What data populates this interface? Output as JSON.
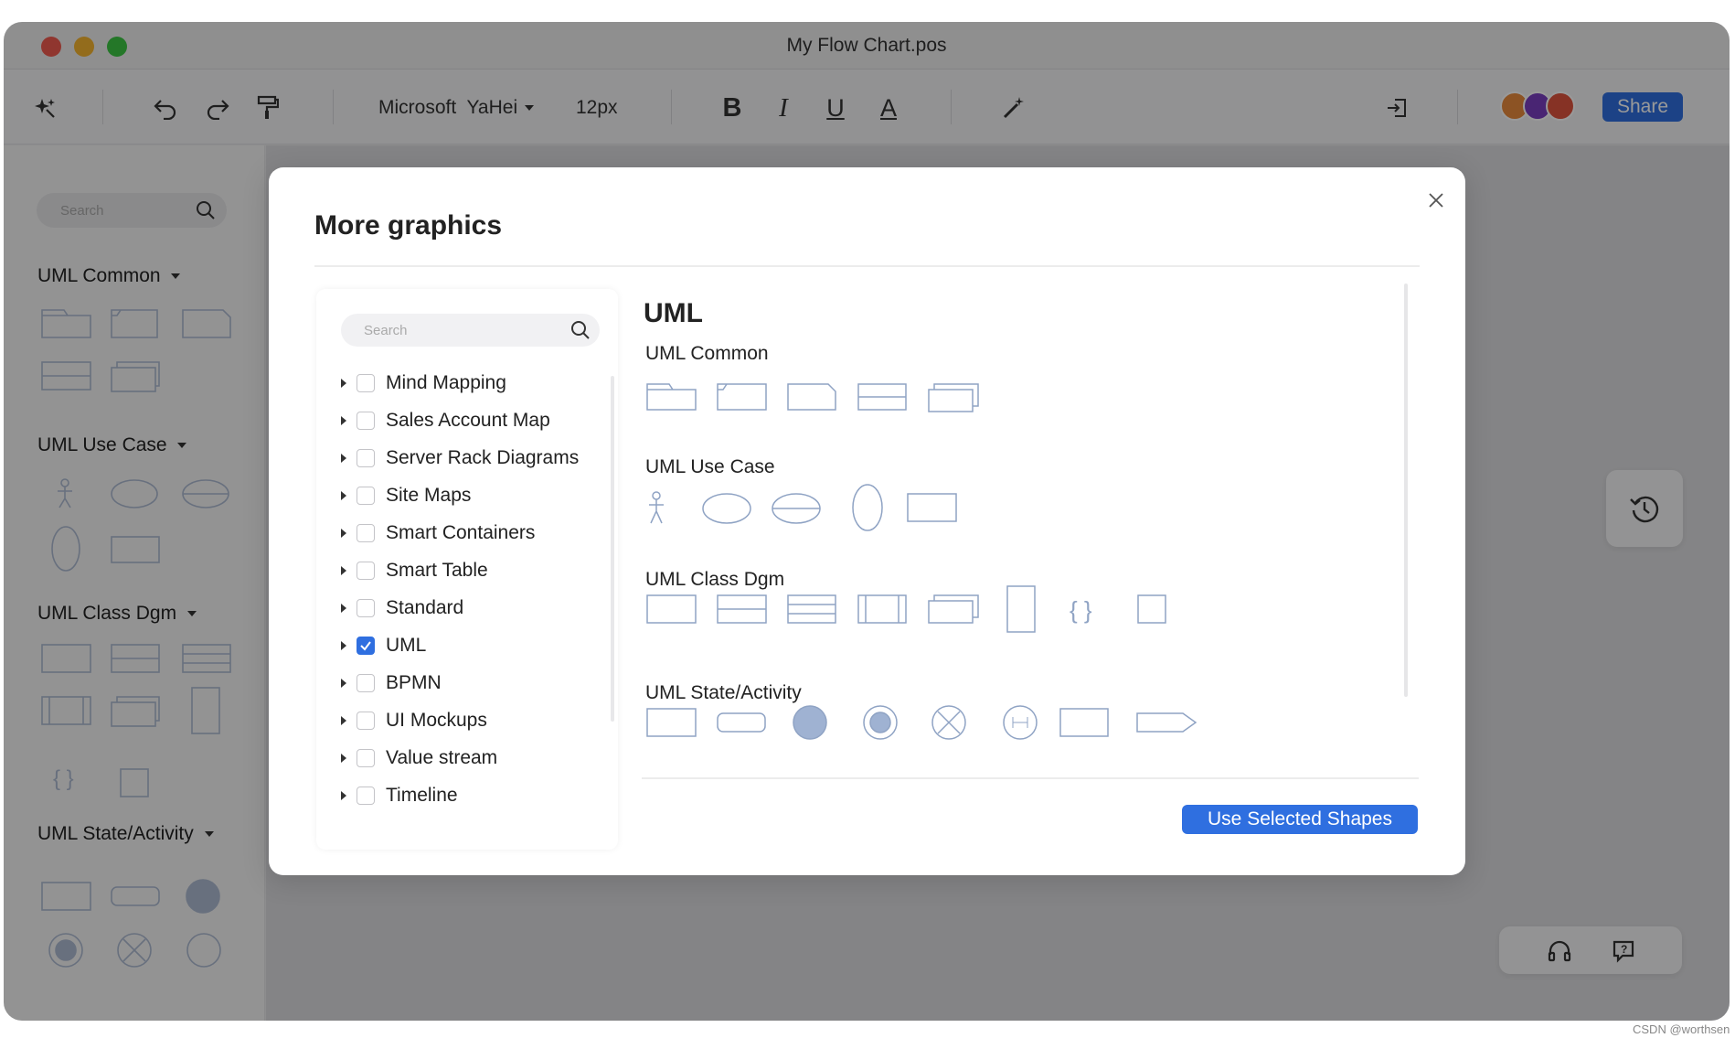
{
  "window": {
    "title": "My Flow Chart.pos"
  },
  "toolbar": {
    "font_family": "Microsoft  YaHei",
    "font_size": "12px",
    "share_label": "Share",
    "icons": [
      "magic-star-icon",
      "undo-icon",
      "redo-icon",
      "format-painter-icon",
      "bold-icon",
      "italic-icon",
      "underline-icon",
      "font-color-icon",
      "magic-wand-icon",
      "export-icon"
    ]
  },
  "sidebar": {
    "search_placeholder": "Search",
    "sections": [
      "UML Common",
      "UML Use Case",
      "UML Class Dgm",
      "UML State/Activity"
    ]
  },
  "modal": {
    "title": "More graphics",
    "search_placeholder": "Search",
    "categories": [
      {
        "label": "Mind Mapping",
        "checked": false
      },
      {
        "label": "Sales Account Map",
        "checked": false
      },
      {
        "label": "Server Rack Diagrams",
        "checked": false
      },
      {
        "label": "Site Maps",
        "checked": false
      },
      {
        "label": "Smart Containers",
        "checked": false
      },
      {
        "label": "Smart Table",
        "checked": false
      },
      {
        "label": "Standard",
        "checked": false
      },
      {
        "label": "UML",
        "checked": true
      },
      {
        "label": "BPMN",
        "checked": false
      },
      {
        "label": "UI Mockups",
        "checked": false
      },
      {
        "label": "Value stream",
        "checked": false
      },
      {
        "label": "Timeline",
        "checked": false
      }
    ],
    "gallery": {
      "heading": "UML",
      "groups": [
        "UML Common",
        "UML Use Case",
        "UML Class Dgm",
        "UML State/Activity"
      ]
    },
    "use_button": "Use Selected Shapes"
  },
  "colors": {
    "accent": "#2f6fe0",
    "shape_stroke": "#8fa3c4",
    "shape_fill": "#9fb2d2"
  },
  "footer": {
    "watermark": "CSDN @worthsen"
  }
}
